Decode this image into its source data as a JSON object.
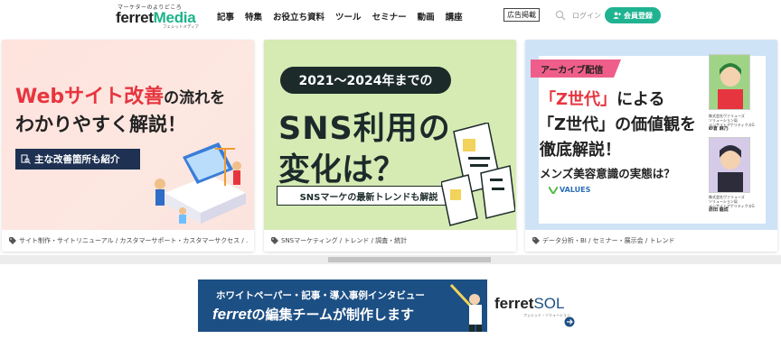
{
  "header": {
    "logo_tagline": "マーケターのよりどころ",
    "logo_word_a": "ferret",
    "logo_word_b": "Media",
    "logo_sub": "フェレットメディア",
    "nav": [
      "記事",
      "特集",
      "お役立ち資料",
      "ツール",
      "セミナー",
      "動画",
      "講座"
    ],
    "ad_label": "広告掲載",
    "login_label": "ログイン",
    "register_label": "会員登録",
    "brand_color": "#1fb391"
  },
  "cards": [
    {
      "line1_red": "Webサイト改善",
      "line1_rest": "の流れを",
      "line2": "わかりやすく解説！",
      "label": "主な改善箇所も紹介",
      "tags": "サイト制作・サイトリニューアル / カスタマーサポート・カスタマーサクセス / ..."
    },
    {
      "pill": "2021～2024年までの",
      "big1": "SNS利用の",
      "big2": "変化は？",
      "strip": "SNSマーケの最新トレンドも解説",
      "tags": "SNSマーケティング / トレンド / 調査・統計"
    },
    {
      "archive": "アーカイブ配信",
      "l1_red": "「Z世代」",
      "l1_rest": "による",
      "l2_red": "「Z世代」",
      "l2_rest": "の価値観を",
      "l3": "徹底解説！",
      "l4": "メンズ美容意識の実態は？",
      "values": "VALUES",
      "speaker1": [
        "株式会社ヴァリューズ",
        "ソリューション局",
        "インサイトアナリティクスG",
        "紗倉 麻乃"
      ],
      "speaker2": [
        "株式会社ヴァリューズ",
        "ソリューション局",
        "インサイトアナリティクスG",
        "原田 龍成"
      ],
      "tags": "データ分析・BI / セミナー・展示会 / トレンド"
    }
  ],
  "bottom_banner": {
    "line1": "ホワイトペーパー・記事・導入事例インタビュー",
    "line2_brand": "ferret",
    "line2_rest": "の編集チームが制作します",
    "logo_a": "ferret",
    "logo_b": "SOL",
    "logo_sub": "フェレット・ソリューション"
  }
}
